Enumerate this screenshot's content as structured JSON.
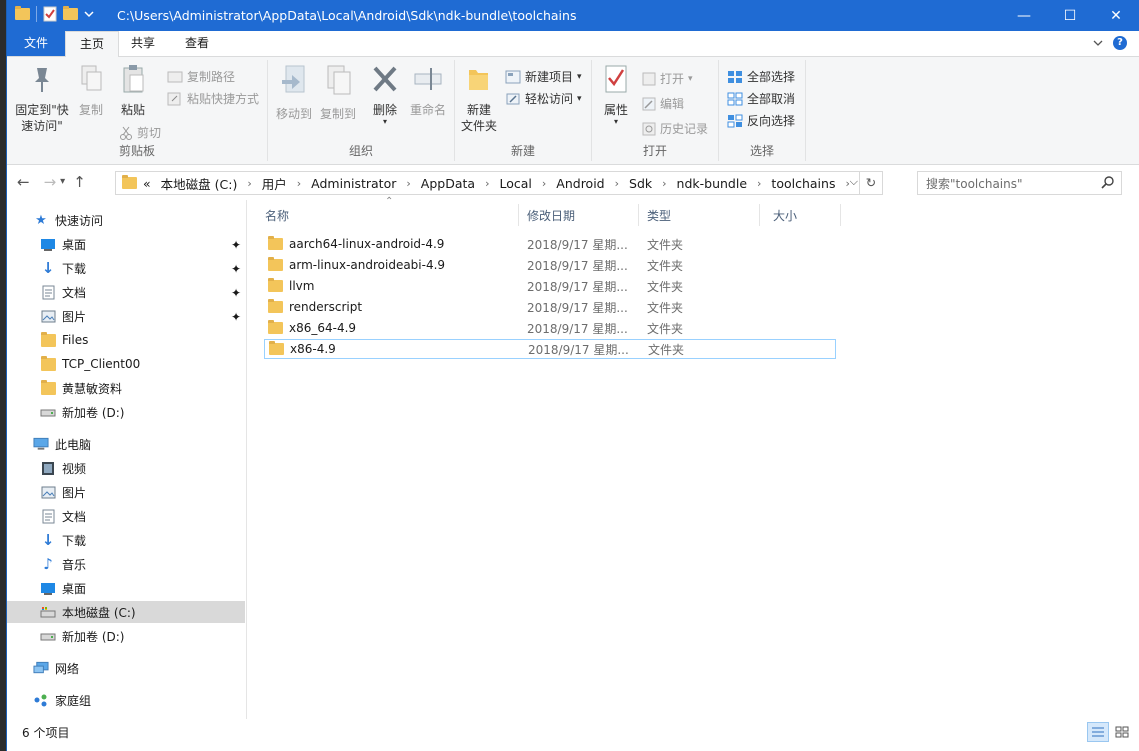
{
  "titlebar": {
    "path": "C:\\Users\\Administrator\\AppData\\Local\\Android\\Sdk\\ndk-bundle\\toolchains",
    "controls": {
      "minimize": "—",
      "maximize": "☐",
      "close": "✕"
    }
  },
  "tabs": {
    "file": "文件",
    "home": "主页",
    "share": "共享",
    "view": "查看"
  },
  "ribbon": {
    "clipboard": {
      "label": "剪贴板",
      "pin": "固定到\"快\n速访问\"",
      "copy": "复制",
      "paste": "粘贴",
      "copy_path": "复制路径",
      "paste_shortcut": "粘贴快捷方式",
      "cut": "剪切"
    },
    "organize": {
      "label": "组织",
      "move_to": "移动到",
      "copy_to": "复制到",
      "delete": "删除",
      "rename": "重命名"
    },
    "new": {
      "label": "新建",
      "new_folder": "新建\n文件夹",
      "new_item": "新建项目",
      "easy_access": "轻松访问"
    },
    "open": {
      "label": "打开",
      "properties": "属性",
      "open": "打开",
      "edit": "编辑",
      "history": "历史记录"
    },
    "select": {
      "label": "选择",
      "select_all": "全部选择",
      "select_none": "全部取消",
      "invert": "反向选择"
    }
  },
  "address": {
    "prefix": "«",
    "crumbs": [
      "本地磁盘 (C:)",
      "用户",
      "Administrator",
      "AppData",
      "Local",
      "Android",
      "Sdk",
      "ndk-bundle",
      "toolchains"
    ]
  },
  "search": {
    "placeholder": "搜索\"toolchains\""
  },
  "navpane": {
    "quick_access": "快速访问",
    "quick_items": [
      "桌面",
      "下载",
      "文档",
      "图片",
      "Files",
      "TCP_Client00",
      "黄慧敏资料",
      "新加卷 (D:)"
    ],
    "this_pc": "此电脑",
    "pc_items": [
      "视频",
      "图片",
      "文档",
      "下载",
      "音乐",
      "桌面",
      "本地磁盘 (C:)",
      "新加卷 (D:)"
    ],
    "network": "网络",
    "homegroup": "家庭组"
  },
  "columns": {
    "name": "名称",
    "date": "修改日期",
    "type": "类型",
    "size": "大小"
  },
  "files": [
    {
      "name": "aarch64-linux-android-4.9",
      "date": "2018/9/17 星期...",
      "type": "文件夹"
    },
    {
      "name": "arm-linux-androideabi-4.9",
      "date": "2018/9/17 星期...",
      "type": "文件夹"
    },
    {
      "name": "llvm",
      "date": "2018/9/17 星期...",
      "type": "文件夹"
    },
    {
      "name": "renderscript",
      "date": "2018/9/17 星期...",
      "type": "文件夹"
    },
    {
      "name": "x86_64-4.9",
      "date": "2018/9/17 星期...",
      "type": "文件夹"
    },
    {
      "name": "x86-4.9",
      "date": "2018/9/17 星期...",
      "type": "文件夹"
    }
  ],
  "status": {
    "count": "6 个项目"
  },
  "colors": {
    "accent": "#1f6bd3",
    "folder": "#f3c55a"
  }
}
